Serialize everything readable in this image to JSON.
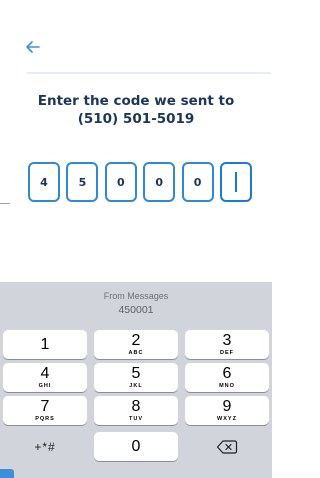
{
  "header": {
    "back_icon": "arrow-left-icon"
  },
  "prompt": {
    "line1": "Enter the code we sent to",
    "line2": "(510) 501-5019"
  },
  "code_digits": [
    "4",
    "5",
    "0",
    "0",
    "0",
    ""
  ],
  "keyboard": {
    "suggestion_label": "From Messages",
    "suggestion_code": "450001",
    "keys": [
      {
        "num": "1",
        "letters": ""
      },
      {
        "num": "2",
        "letters": "ABC"
      },
      {
        "num": "3",
        "letters": "DEF"
      },
      {
        "num": "4",
        "letters": "GHI"
      },
      {
        "num": "5",
        "letters": "JKL"
      },
      {
        "num": "6",
        "letters": "MNO"
      },
      {
        "num": "7",
        "letters": "PQRS"
      },
      {
        "num": "8",
        "letters": "TUV"
      },
      {
        "num": "9",
        "letters": "WXYZ"
      }
    ],
    "symbols_label": "+*#",
    "zero": "0",
    "delete_icon": "backspace-icon"
  },
  "colors": {
    "accent": "#2f88d8",
    "title": "#1d3557",
    "keyboard_bg": "#d1d4da"
  }
}
